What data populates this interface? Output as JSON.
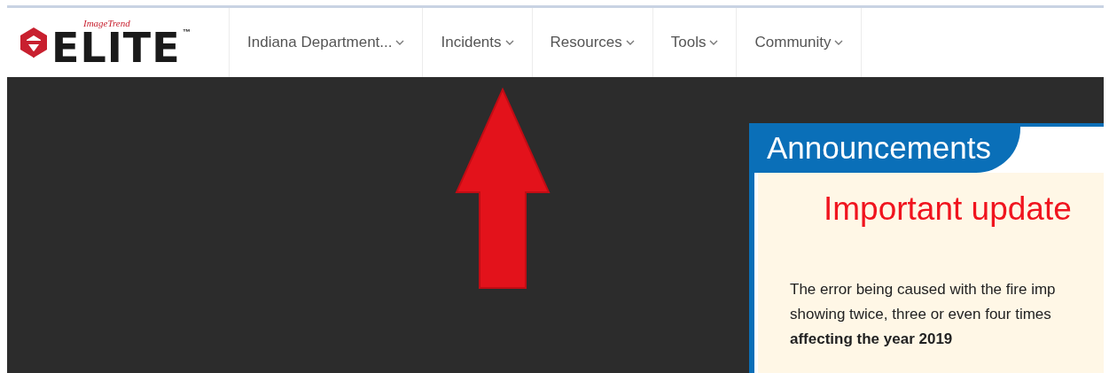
{
  "logo": {
    "brand": "ImageTrend",
    "product": "ELITE",
    "mark": "™"
  },
  "nav": [
    {
      "label": "Indiana Department..."
    },
    {
      "label": "Incidents"
    },
    {
      "label": "Resources"
    },
    {
      "label": "Tools"
    },
    {
      "label": "Community"
    }
  ],
  "announcements": {
    "title": "Announcements",
    "heading": "Important update",
    "lines": [
      "The error being caused with the fire imp",
      "showing twice, three or even four times",
      "**affecting the year 2019**"
    ]
  }
}
